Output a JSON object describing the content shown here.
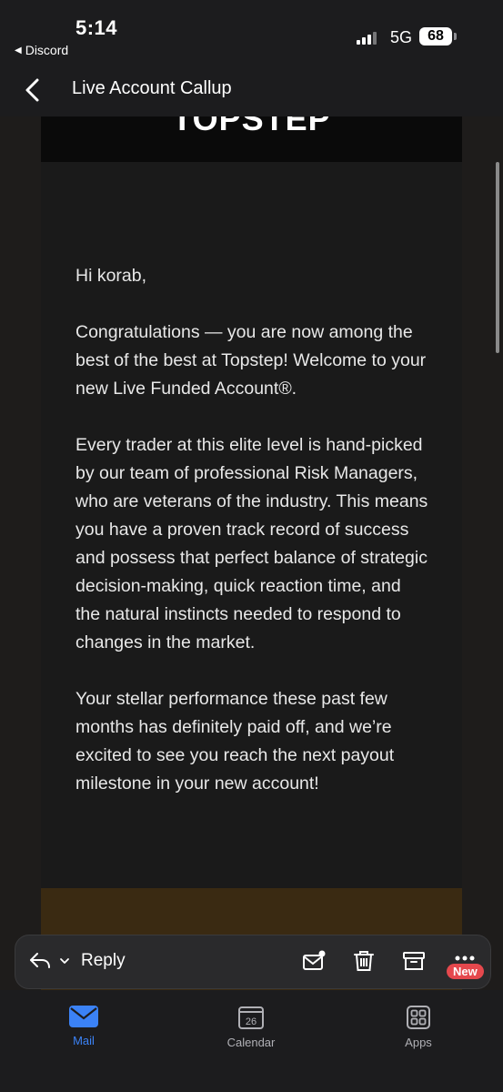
{
  "status_bar": {
    "time": "5:14",
    "back_app": "Discord",
    "network": "5G",
    "battery": "68"
  },
  "header": {
    "title": "Live Account Callup"
  },
  "email": {
    "logo_text": "TOPSTEP",
    "greeting": "Hi korab,",
    "paragraphs": [
      "Congratulations — you are now among the best of the best at Topstep! Welcome to your new Live Funded Account®.",
      "Every trader at this elite level is hand-picked by our team of professional Risk Managers, who are veterans of the industry. This means you have a proven track record of success and possess that perfect balance of strategic decision-making, quick reaction time, and the natural instincts needed to respond to changes in the market.",
      "Your stellar performance these past few months has definitely paid off, and we’re excited to see you reach the next payout milestone in your new account!"
    ]
  },
  "action_bar": {
    "reply_label": "Reply",
    "new_badge": "New",
    "icons": [
      "reply-icon",
      "chevron-down-icon",
      "mark-unread-icon",
      "trash-icon",
      "archive-icon",
      "more-icon"
    ]
  },
  "tabs": [
    {
      "label": "Mail",
      "icon": "mail-icon",
      "active": true
    },
    {
      "label": "Calendar",
      "icon": "calendar-icon",
      "day": "26",
      "active": false
    },
    {
      "label": "Apps",
      "icon": "apps-icon",
      "active": false
    }
  ],
  "colors": {
    "accent": "#3b82f6",
    "badge": "#e5484d",
    "brown_band": "#3a2a12"
  }
}
